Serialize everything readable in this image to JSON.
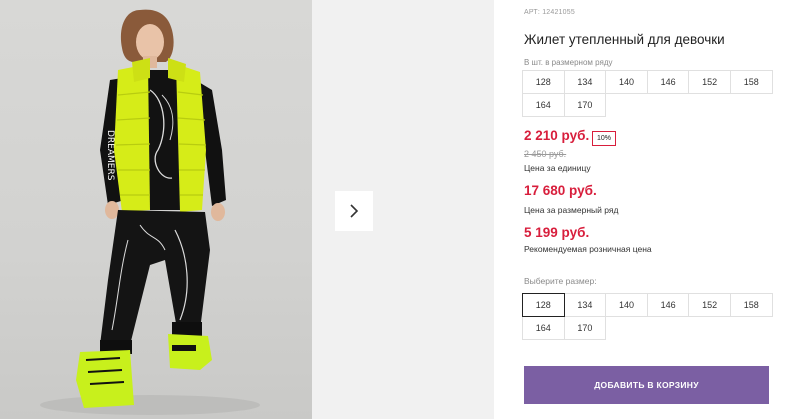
{
  "product": {
    "article": "АРТ: 12421055",
    "title": "Жилет утепленный для девочки",
    "image_alt": "photo-of-child-in-yellow-vest"
  },
  "gallery": {
    "next_icon": "chevron-right-icon"
  },
  "set_sizes": {
    "label": "В шт. в размерном ряду",
    "sizes": [
      "128",
      "134",
      "140",
      "146",
      "152",
      "158",
      "164",
      "170"
    ]
  },
  "pricing": {
    "price": "2 210 руб.",
    "discount": "10%",
    "old_price": "2 450 руб.",
    "unit_note": "Цена за единицу",
    "set_price": "17 680 руб.",
    "set_note": "Цена за размерный ряд",
    "rrp": "5 199 руб.",
    "rrp_note": "Рекомендуемая розничная цена"
  },
  "size_select": {
    "label": "Выберите размер:",
    "sizes": [
      "128",
      "134",
      "140",
      "146",
      "152",
      "158",
      "164",
      "170"
    ],
    "selected": "128"
  },
  "cart": {
    "add_label": "ДОБАВИТЬ В КОРЗИНУ"
  },
  "colors": {
    "accent_red": "#d81e3c",
    "button_purple": "#7b5fa3",
    "vest_yellow": "#d6ec18"
  }
}
